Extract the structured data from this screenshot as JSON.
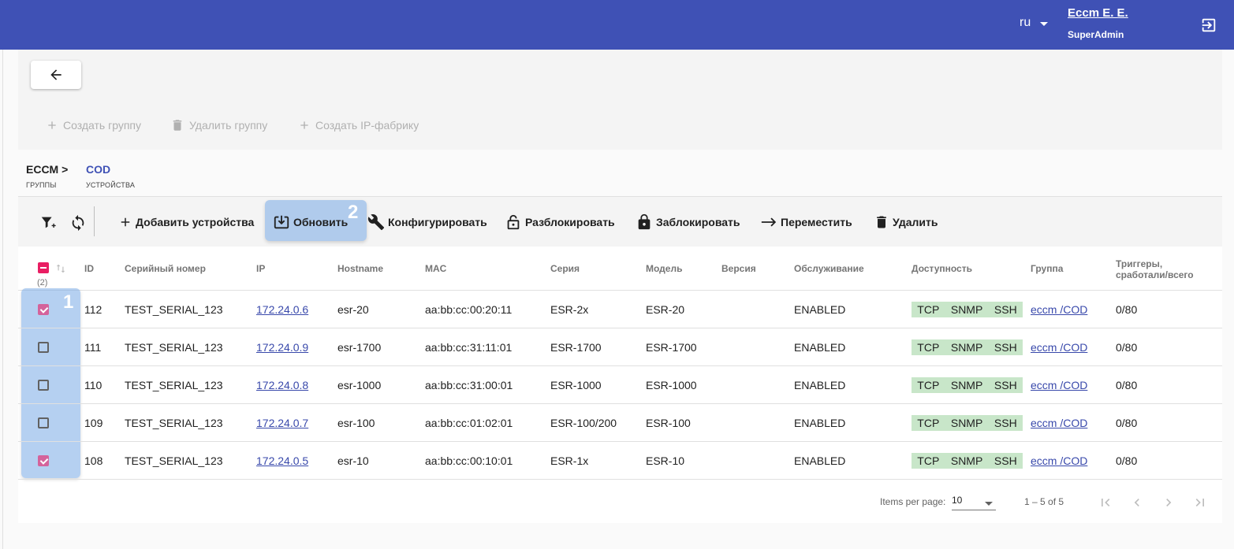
{
  "header": {
    "language": "ru",
    "user_name": "Eccm E. E.",
    "user_role": "SuperAdmin"
  },
  "group_actions": {
    "create_group": "Создать группу",
    "delete_group": "Удалить группу",
    "create_ip_fabric": "Создать IP-фабрику"
  },
  "breadcrumb": {
    "root": "ECCM >",
    "root_sub": "ГРУППЫ",
    "current": "COD",
    "current_sub": "УСТРОЙСТВА"
  },
  "toolbar": {
    "add_devices": "Добавить устройства",
    "refresh": "Обновить",
    "configure": "Конфигурировать",
    "unlock": "Разблокировать",
    "lock": "Заблокировать",
    "move": "Переместить",
    "delete": "Удалить"
  },
  "annotations": {
    "marker_1": "1",
    "marker_2": "2"
  },
  "table": {
    "selected_count": "(2)",
    "columns": {
      "id": "ID",
      "serial": "Серийный номер",
      "ip": "IP",
      "hostname": "Hostname",
      "mac": "MAC",
      "series": "Серия",
      "model": "Модель",
      "version": "Версия",
      "service": "Обслуживание",
      "availability": "Доступность",
      "group": "Группа",
      "triggers_line1": "Триггеры,",
      "triggers_line2": "сработали/всего"
    },
    "rows": [
      {
        "checked": true,
        "id": "112",
        "serial": "TEST_SERIAL_123",
        "ip": "172.24.0.6",
        "hostname": "esr-20",
        "mac": "aa:bb:cc:00:20:11",
        "series": "ESR-2x",
        "model": "ESR-20",
        "version": "",
        "service": "ENABLED",
        "avail": [
          "TCP",
          "SNMP",
          "SSH"
        ],
        "group": "eccm /COD",
        "triggers": "0/80"
      },
      {
        "checked": false,
        "id": "111",
        "serial": "TEST_SERIAL_123",
        "ip": "172.24.0.9",
        "hostname": "esr-1700",
        "mac": "aa:bb:cc:31:11:01",
        "series": "ESR-1700",
        "model": "ESR-1700",
        "version": "",
        "service": "ENABLED",
        "avail": [
          "TCP",
          "SNMP",
          "SSH"
        ],
        "group": "eccm /COD",
        "triggers": "0/80"
      },
      {
        "checked": false,
        "id": "110",
        "serial": "TEST_SERIAL_123",
        "ip": "172.24.0.8",
        "hostname": "esr-1000",
        "mac": "aa:bb:cc:31:00:01",
        "series": "ESR-1000",
        "model": "ESR-1000",
        "version": "",
        "service": "ENABLED",
        "avail": [
          "TCP",
          "SNMP",
          "SSH"
        ],
        "group": "eccm /COD",
        "triggers": "0/80"
      },
      {
        "checked": false,
        "id": "109",
        "serial": "TEST_SERIAL_123",
        "ip": "172.24.0.7",
        "hostname": "esr-100",
        "mac": "aa:bb:cc:01:02:01",
        "series": "ESR-100/200",
        "model": "ESR-100",
        "version": "",
        "service": "ENABLED",
        "avail": [
          "TCP",
          "SNMP",
          "SSH"
        ],
        "group": "eccm /COD",
        "triggers": "0/80"
      },
      {
        "checked": true,
        "id": "108",
        "serial": "TEST_SERIAL_123",
        "ip": "172.24.0.5",
        "hostname": "esr-10",
        "mac": "aa:bb:cc:00:10:01",
        "series": "ESR-1x",
        "model": "ESR-10",
        "version": "",
        "service": "ENABLED",
        "avail": [
          "TCP",
          "SNMP",
          "SSH"
        ],
        "group": "eccm /COD",
        "triggers": "0/80"
      }
    ]
  },
  "paginator": {
    "items_per_page_label": "Items per page:",
    "items_per_page": "10",
    "range": "1 – 5 of 5"
  },
  "colors": {
    "primary": "#3f51b5",
    "accent": "#e91e63",
    "checked": "#d4639b",
    "availability_bg": "#c8e6c9",
    "highlight": "#78aae6"
  }
}
